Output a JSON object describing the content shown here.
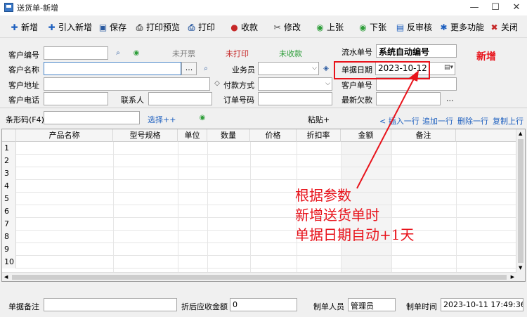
{
  "window": {
    "title": "送货单-新增",
    "min": "—",
    "max": "☐",
    "close": "✕"
  },
  "toolbar": [
    {
      "icon": "plus-icon",
      "glyph": "✚",
      "label": "新增",
      "color": "#1d5fbf"
    },
    {
      "icon": "plus-icon",
      "glyph": "✚",
      "label": "引入新增",
      "color": "#1d5fbf"
    },
    {
      "icon": "save-icon",
      "glyph": "▣",
      "label": "保存",
      "color": "#2a5aa0"
    },
    {
      "icon": "print-preview-icon",
      "glyph": "⎙",
      "label": "打印预览",
      "color": "#555"
    },
    {
      "icon": "print-icon",
      "glyph": "⎙",
      "label": "打印",
      "color": "#2a5aa0"
    },
    {
      "icon": "coins-icon",
      "glyph": "●",
      "label": "收款",
      "color": "#c62828"
    },
    {
      "icon": "edit-icon",
      "glyph": "✂",
      "label": "修改",
      "color": "#555"
    },
    {
      "icon": "prev-icon",
      "glyph": "◉",
      "label": "上张",
      "color": "#2e9e3a"
    },
    {
      "icon": "next-icon",
      "glyph": "◉",
      "label": "下张",
      "color": "#2e9e3a"
    },
    {
      "icon": "unapprove-icon",
      "glyph": "▤",
      "label": "反审核",
      "color": "#1d5fbf"
    },
    {
      "icon": "gear-icon",
      "glyph": "✱",
      "label": "更多功能",
      "color": "#1d5fbf"
    },
    {
      "icon": "close-icon",
      "glyph": "✖",
      "label": "关闭",
      "color": "#c62828"
    }
  ],
  "form": {
    "customer_code_label": "客户编号",
    "customer_name_label": "客户名称",
    "customer_address_label": "客户地址",
    "customer_phone_label": "客户电话",
    "contact_label": "联系人",
    "status_invoice": "未开票",
    "status_print": "未打印",
    "status_collect": "未收款",
    "salesman_label": "业务员",
    "payment_label": "付款方式",
    "order_no_label": "订单号码",
    "serial_label": "流水单号",
    "serial_value": "系统自动编号",
    "date_label": "单据日期",
    "date_value": "2023-10-12",
    "customer_order_label": "客户单号",
    "latest_debt_label": "最新欠款",
    "browse_button": "...",
    "more_button": "..."
  },
  "barcode": {
    "label": "条形码(F4)",
    "select_link": "选择++",
    "paste_label": "粘贴+",
    "insert_row": "< 插入一行",
    "append_row": "追加一行",
    "delete_row": "删除一行",
    "copy_prev": "复制上行"
  },
  "grid": {
    "columns": [
      "产品名称",
      "型号规格",
      "单位",
      "数量",
      "价格",
      "折扣率",
      "金额",
      "备注"
    ],
    "rows": [
      "1",
      "2",
      "3",
      "4",
      "5",
      "6",
      "7",
      "8",
      "9",
      "10"
    ]
  },
  "footer": {
    "remark_label": "单据备注",
    "discount_amount_label": "折后应收金额",
    "discount_amount_value": "0",
    "maker_label": "制单人员",
    "maker_value": "管理员",
    "make_time_label": "制单时间",
    "make_time_value": "2023-10-11 17:49:36"
  },
  "annotation": {
    "new_tag": "新增",
    "line1": "根据参数",
    "line2": "新增送货单时",
    "line3": "单据日期自动+1天"
  },
  "colors": {
    "red": "#e8131b",
    "green": "#2e9e3a",
    "link": "#1d5fbf"
  }
}
